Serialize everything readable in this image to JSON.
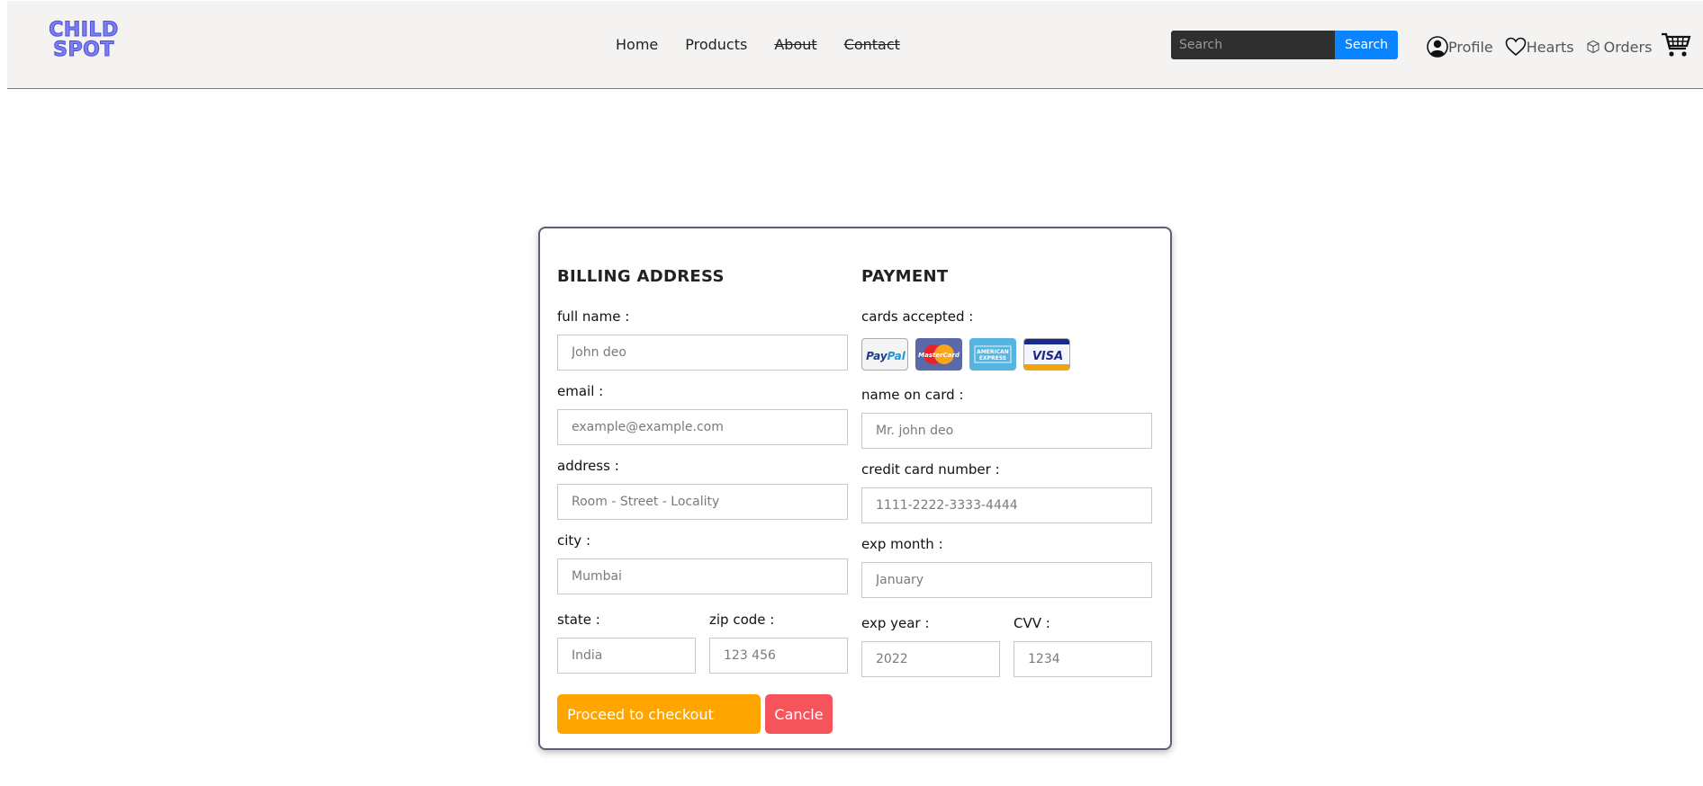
{
  "brand": {
    "line1": "CHILD",
    "line2": "SPOT"
  },
  "nav": {
    "links": [
      {
        "label": "Home"
      },
      {
        "label": "Products"
      },
      {
        "label": "About"
      },
      {
        "label": "Contact"
      }
    ],
    "search": {
      "placeholder": "Search",
      "button": "Search"
    },
    "icons": [
      {
        "label": "Profile",
        "icon": "user-circle-icon"
      },
      {
        "label": "Hearts",
        "icon": "heart-icon"
      },
      {
        "label": "Orders",
        "icon": "box-icon"
      }
    ],
    "cart_icon": "cart-icon"
  },
  "billing": {
    "title": "BILLING ADDRESS",
    "full_name": {
      "label": "full name :",
      "placeholder": "John deo"
    },
    "email": {
      "label": "email :",
      "placeholder": "example@example.com"
    },
    "address": {
      "label": "address :",
      "placeholder": "Room - Street - Locality"
    },
    "city": {
      "label": "city :",
      "placeholder": "Mumbai"
    },
    "state": {
      "label": "state :",
      "placeholder": "India"
    },
    "zip": {
      "label": "zip code :",
      "placeholder": "123 456"
    }
  },
  "payment": {
    "title": "PAYMENT",
    "cards_label": "cards accepted :",
    "cards": [
      {
        "name": "PayPal",
        "icon": "paypal-icon"
      },
      {
        "name": "MasterCard",
        "icon": "mastercard-icon"
      },
      {
        "name": "AMERICAN EXPRESS",
        "icon": "amex-icon"
      },
      {
        "name": "VISA",
        "icon": "visa-icon"
      }
    ],
    "name_on_card": {
      "label": "name on card :",
      "placeholder": "Mr. john deo"
    },
    "card_number": {
      "label": "credit card number :",
      "placeholder": "1111-2222-3333-4444"
    },
    "exp_month": {
      "label": "exp month :",
      "placeholder": "January"
    },
    "exp_year": {
      "label": "exp year :",
      "placeholder": "2022"
    },
    "cvv": {
      "label": "CVV :",
      "placeholder": "1234"
    }
  },
  "actions": {
    "checkout": "Proceed to checkout",
    "cancel": "Cancle"
  },
  "colors": {
    "navbar_bg": "#f4f3f1",
    "brand": "#7b7ff2",
    "search_button": "#0a84ff",
    "checkout": "#ffa500",
    "cancel": "#f5555a"
  }
}
